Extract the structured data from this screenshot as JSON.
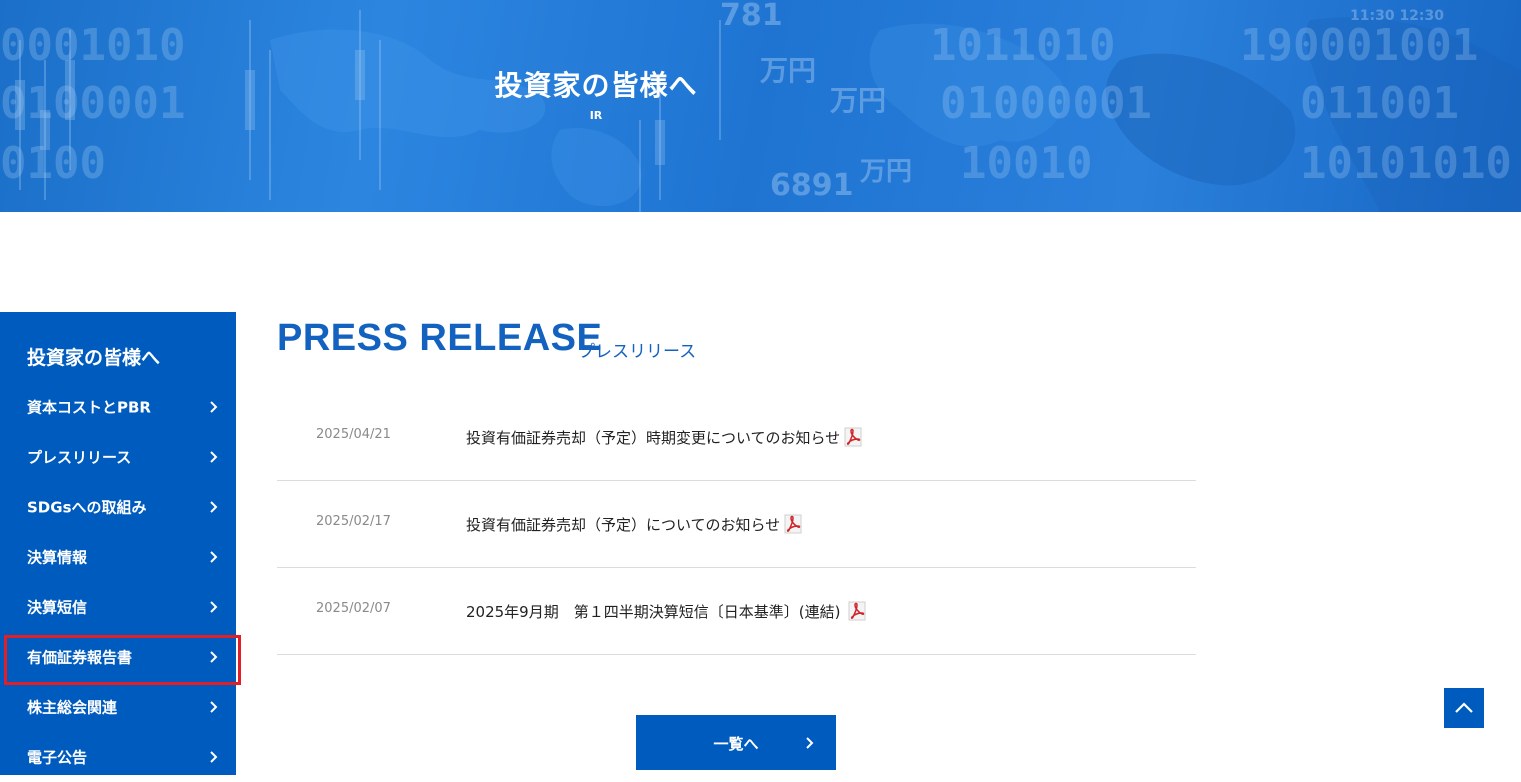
{
  "hero": {
    "title": "投資家の皆様へ",
    "subtitle": "IR"
  },
  "sidebar": {
    "heading": "投資家の皆様へ",
    "items": [
      {
        "label": "資本コストとPBR"
      },
      {
        "label": "プレスリリース"
      },
      {
        "label": "SDGsへの取組み"
      },
      {
        "label": "決算情報"
      },
      {
        "label": "決算短信"
      },
      {
        "label": "有価証券報告書",
        "highlighted": true
      },
      {
        "label": "株主総会関連"
      },
      {
        "label": "電子公告"
      }
    ]
  },
  "press": {
    "title": "PRESS RELEASE",
    "subtitle": "プレスリリース",
    "items": [
      {
        "date": "2025/04/21",
        "title": "投資有価証券売却（予定）時期変更についてのお知らせ",
        "icon": "pdf-icon"
      },
      {
        "date": "2025/02/17",
        "title": "投資有価証券売却（予定）についてのお知らせ",
        "icon": "pdf-icon"
      },
      {
        "date": "2025/02/07",
        "title": "2025年9月期　第１四半期決算短信〔日本基準〕(連結)",
        "icon": "pdf-icon"
      }
    ],
    "more_label": "一覧へ"
  },
  "colors": {
    "brand_blue": "#005bbf",
    "title_blue": "#1362bf",
    "highlight_red": "#e21f26"
  }
}
